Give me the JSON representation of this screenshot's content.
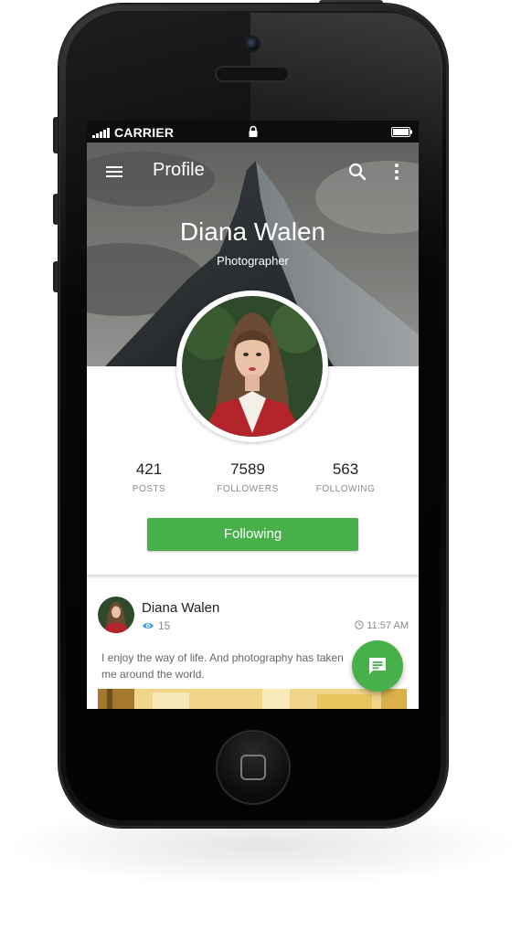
{
  "status_bar": {
    "carrier": "CARRIER",
    "icons": [
      "signal-icon",
      "lock-icon",
      "battery-icon"
    ]
  },
  "toolbar": {
    "title": "Profile",
    "icons": [
      "menu-icon",
      "search-icon",
      "more-vert-icon"
    ]
  },
  "profile": {
    "name": "Diana Walen",
    "role": "Photographer"
  },
  "stats": [
    {
      "value": "421",
      "label": "POSTS"
    },
    {
      "value": "7589",
      "label": "FOLLOWERS"
    },
    {
      "value": "563",
      "label": "FOLLOWING"
    }
  ],
  "follow_button": {
    "label": "Following"
  },
  "post": {
    "author": "Diana Walen",
    "views": "15",
    "time": "11:57 AM",
    "text": "I enjoy the way of life. And photography has taken me around the world."
  },
  "fab": {
    "icon": "message-icon"
  },
  "colors": {
    "accent": "#47b04b",
    "status_bar": "#0d0d0d",
    "stat_label": "#8a8a8a",
    "eye_icon": "#4aa3df"
  }
}
